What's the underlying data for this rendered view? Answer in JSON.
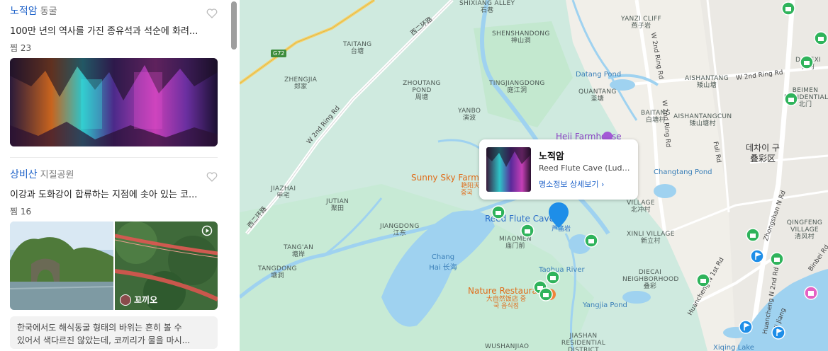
{
  "places": [
    {
      "name": "노적암",
      "category": "동굴",
      "description": "100만 년의 역사를 가진 종유석과 석순에 화려...",
      "likes": "찜 23"
    },
    {
      "name": "상비산",
      "category": "지질공원",
      "description": "이강과 도화강이 합류하는 지점에 솟아 있는 코...",
      "likes": "찜 16",
      "author": "꼬끼오",
      "review_lines": [
        "한국에서도 해식동굴 형태의 바위는 흔히 볼 수",
        "있어서 색다르진 않았는데, 코끼리가 물을 마시..."
      ]
    }
  ],
  "popup": {
    "title": "노적암",
    "subtitle": "Reed Flute Cave (Ludi Y...",
    "link": "명소정보 상세보기 ›"
  },
  "map": {
    "areas": [
      {
        "en": "SHIXIANG ALLEY",
        "ko": "石巷"
      },
      {
        "en": "SHENSHANDONG",
        "ko": "神山洞"
      },
      {
        "en": "TAITANG",
        "ko": "台塘"
      },
      {
        "en": "ZHENGJIA",
        "ko": "郑家"
      },
      {
        "en": "ZHOUTANG POND",
        "ko": "周塘"
      },
      {
        "en": "TINGJIANGDONG",
        "ko": "庭江洞"
      },
      {
        "en": "YANBO",
        "ko": "演波"
      },
      {
        "en": "QUANTANG",
        "ko": "荃塘"
      },
      {
        "en": "YANZI CLIFF",
        "ko": "燕子岩"
      },
      {
        "en": "AISHANTANG",
        "ko": "矮山塘"
      },
      {
        "en": "BAITANG",
        "ko": "白塘村"
      },
      {
        "en": "AISHANTANGCUN",
        "ko": "矮山塘村"
      },
      {
        "en": "DAHEXI",
        "ko": "大河"
      },
      {
        "en": "BEIMEN RESIDENTIAL",
        "ko": "北门"
      },
      {
        "en": "JIAZHAI",
        "ko": "甲宅"
      },
      {
        "en": "JUTIAN",
        "ko": "聚田"
      },
      {
        "en": "JIANGDONG",
        "ko": "江东"
      },
      {
        "en": "TANG'AN",
        "ko": "塘岸"
      },
      {
        "en": "TANGDONG",
        "ko": "塘洞"
      },
      {
        "en": "MIAOMEN",
        "ko": "庙门前"
      },
      {
        "en": "XINLI VILLAGE",
        "ko": "新立村"
      },
      {
        "en": "DIECAI NEIGHBORHOOD",
        "ko": "叠彩"
      },
      {
        "en": "QINGFENG VILLAGE",
        "ko": "清风村"
      },
      {
        "en": "JIASHAN RESIDENTIAL DISTRICT",
        "ko": ""
      },
      {
        "en": "WUSHANJIAO",
        "ko": ""
      },
      {
        "en": "VILLAGE",
        "ko": "北冲村"
      }
    ],
    "roads": [
      "G72",
      "西二环路",
      "W 2nd Ring Rd",
      "W 2nd Ring Rd",
      "W 2nd Ring Rd",
      "Fuli Rd",
      "Huancheng N 1st Rd",
      "Zhongshan N Rd",
      "Binbei Rd",
      "Ji Jiang",
      "Huancheng N 2nd Rd",
      "西二环路",
      "W 2nd Ring Rd"
    ],
    "water": [
      "Datang Pond",
      "Changtang Pond",
      "Chang Hai 长海",
      "Taohua River",
      "Yangjia Pond",
      "Xiqing Lake"
    ],
    "pois": [
      {
        "name": "Heji Farmhouse"
      },
      {
        "name": "Sunny Sky Farms",
        "sub": "艳阳天 중국"
      },
      {
        "name": "Reed Flute Cave",
        "sub": "芦笛岩"
      },
      {
        "name": "Nature Restaurant",
        "sub": "大自然饭店 중국 음식점"
      }
    ],
    "district": {
      "ko": "데차이 구",
      "zh": "叠彩区"
    },
    "highway": "G72"
  },
  "colors": {
    "link_blue": "#1e62c9",
    "water": "#9fd2f0",
    "park": "#bfe6cd",
    "pin_green": "#2fb35b",
    "pin_blue": "#1e8ee8",
    "poi_orange": "#e06c1a"
  }
}
